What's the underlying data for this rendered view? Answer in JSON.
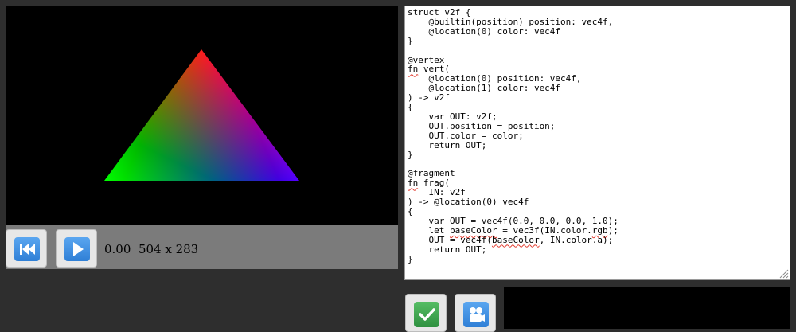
{
  "status": {
    "time": "0.00",
    "resolution": "504 x 283"
  },
  "controls": {
    "rewind_icon": "rewind-to-start-icon",
    "play_icon": "play-icon",
    "accent_blue": "#3a8ee6"
  },
  "actions": {
    "apply_icon": "checkmark-icon",
    "capture_icon": "camera-user-icon",
    "accent_green": "#3fa34d"
  },
  "canvas": {
    "vertex_colors": [
      "#ff0000",
      "#00ff00",
      "#0000ff"
    ],
    "background": "#000000"
  },
  "editor": {
    "lines": [
      {
        "segments": [
          {
            "text": "struct v2f {"
          }
        ]
      },
      {
        "segments": [
          {
            "text": "    @builtin(position) position: vec4f,"
          }
        ]
      },
      {
        "segments": [
          {
            "text": "    @location(0) color: vec4f"
          }
        ]
      },
      {
        "segments": [
          {
            "text": "}"
          }
        ]
      },
      {
        "segments": [
          {
            "text": ""
          }
        ]
      },
      {
        "segments": [
          {
            "text": "@vertex"
          }
        ]
      },
      {
        "segments": [
          {
            "text": "fn",
            "squiggle": true
          },
          {
            "text": " vert("
          }
        ]
      },
      {
        "segments": [
          {
            "text": "    @location(0) position: vec4f,"
          }
        ]
      },
      {
        "segments": [
          {
            "text": "    @location(1) color: vec4f"
          }
        ]
      },
      {
        "segments": [
          {
            "text": ") -> v2f"
          }
        ]
      },
      {
        "segments": [
          {
            "text": "{"
          }
        ]
      },
      {
        "segments": [
          {
            "text": "    var OUT: v2f;"
          }
        ]
      },
      {
        "segments": [
          {
            "text": "    OUT.position = position;"
          }
        ]
      },
      {
        "segments": [
          {
            "text": "    OUT.color = color;"
          }
        ]
      },
      {
        "segments": [
          {
            "text": "    return OUT;"
          }
        ]
      },
      {
        "segments": [
          {
            "text": "}"
          }
        ]
      },
      {
        "segments": [
          {
            "text": ""
          }
        ]
      },
      {
        "segments": [
          {
            "text": "@fragment"
          }
        ]
      },
      {
        "segments": [
          {
            "text": "fn",
            "squiggle": true
          },
          {
            "text": " frag("
          }
        ]
      },
      {
        "segments": [
          {
            "text": "    IN: v2f"
          }
        ]
      },
      {
        "segments": [
          {
            "text": ") -> @location(0) vec4f"
          }
        ]
      },
      {
        "segments": [
          {
            "text": "{"
          }
        ]
      },
      {
        "segments": [
          {
            "text": "    var OUT = vec4f(0.0, 0.0, 0.0, 1.0);"
          }
        ]
      },
      {
        "segments": [
          {
            "text": "    let "
          },
          {
            "text": "baseColor",
            "squiggle": true
          },
          {
            "text": " = vec3f(IN.color."
          },
          {
            "text": "rgb",
            "squiggle": true
          },
          {
            "text": ");"
          }
        ]
      },
      {
        "segments": [
          {
            "text": "    OUT = vec4f("
          },
          {
            "text": "baseColor",
            "squiggle": true
          },
          {
            "text": ", IN.color.a);"
          }
        ]
      },
      {
        "segments": [
          {
            "text": "    return OUT;"
          }
        ]
      },
      {
        "segments": [
          {
            "text": "}"
          }
        ]
      }
    ]
  }
}
